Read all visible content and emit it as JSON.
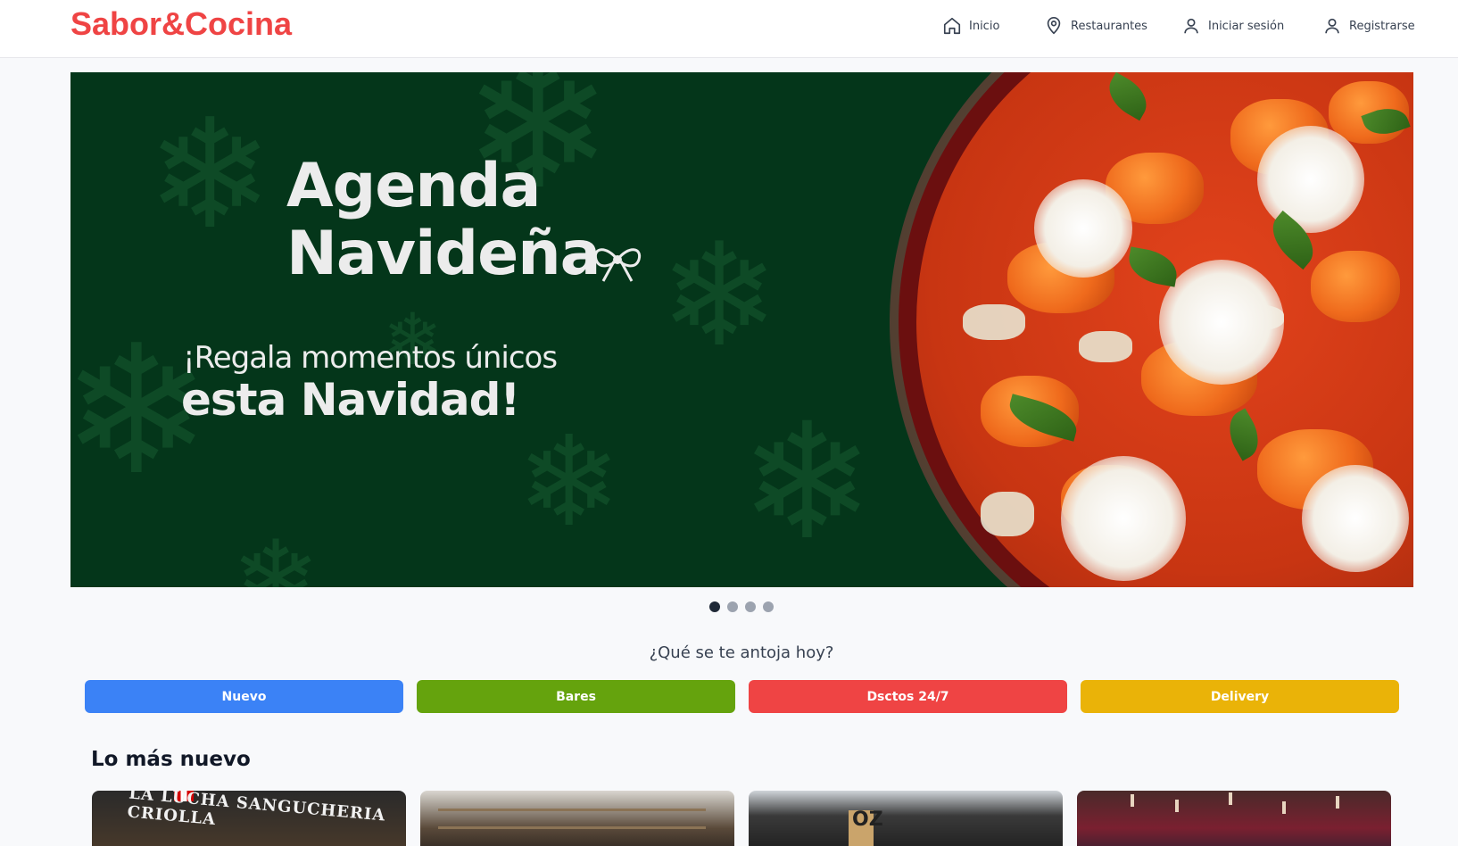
{
  "header": {
    "brand": "Sabor&Cocina",
    "nav": [
      {
        "label": "Inicio",
        "icon": "home-icon"
      },
      {
        "label": "Restaurantes",
        "icon": "map-pin-icon"
      },
      {
        "label": "Iniciar sesión",
        "icon": "user-icon"
      },
      {
        "label": "Registrarse",
        "icon": "user-icon"
      }
    ]
  },
  "hero": {
    "title_line1": "Agenda",
    "title_line2": "Navideña",
    "subtitle_line1": "¡Regala momentos únicos",
    "subtitle_line2": "esta Navidad!",
    "background_color": "#04361a",
    "slides_total": 4,
    "active_slide": 1
  },
  "prompt": "¿Qué se te antoja hoy?",
  "categories": [
    {
      "label": "Nuevo",
      "color": "#3b82f6"
    },
    {
      "label": "Bares",
      "color": "#65a30d"
    },
    {
      "label": "Dsctos 24/7",
      "color": "#ef4444"
    },
    {
      "label": "Delivery",
      "color": "#eab308"
    }
  ],
  "section": {
    "title": "Lo más nuevo",
    "cards": [
      {
        "sign_text": "LA LUCHA SANGUCHERIA CRIOLLA"
      },
      {
        "sign_text": ""
      },
      {
        "sign_text": "OZ"
      },
      {
        "sign_text": ""
      }
    ]
  },
  "colors": {
    "brand": "#ef4444",
    "text": "#1f2937",
    "dot_active": "#1f2937",
    "dot_inactive": "#9ca3af"
  }
}
